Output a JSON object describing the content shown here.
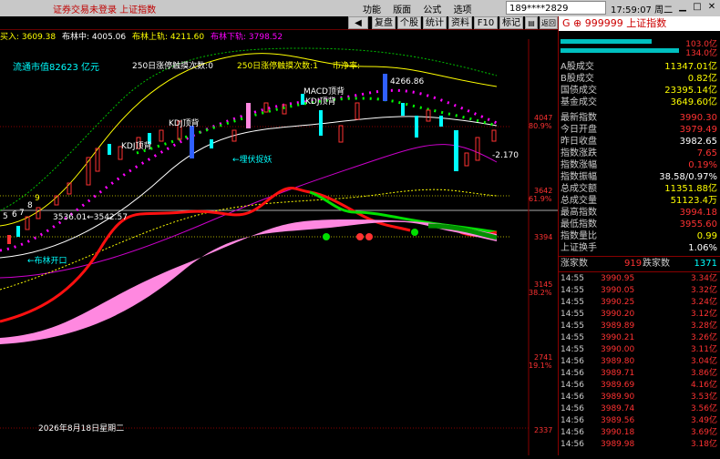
{
  "titlebar": {
    "title": "证券交易未登录  上证指数",
    "menu": [
      "功能",
      "版面",
      "公式",
      "选项"
    ],
    "search_value": "189****2829",
    "clock": "17:59:07 周二"
  },
  "toolbar": {
    "buttons": [
      "",
      "复盘",
      "个股",
      "统计",
      "资料",
      "F10",
      "标记",
      "分类",
      "返回"
    ]
  },
  "indicator_line": {
    "buy": "买入: 3609.38",
    "boll": "布林中: 4005.06",
    "upper": "布林上轨: 4211.60",
    "lower": "布林下轨: 3798.52"
  },
  "chart": {
    "labels": {
      "float_cap": "流通市值82623 亿元",
      "limit_up": "250日涨停触摸次数:0",
      "limit_down": "250日涨停触摸次数:1",
      "net": "市净率:",
      "kdj1": "KDJ顶背",
      "kdj2": "KDJ顶背",
      "macd": "MACD顶背",
      "kdj3": "KDJ顶背",
      "latent": "←埋伏捉妖",
      "boll_open": "←布林开口",
      "high_label": "4266.86",
      "low_label": "3536.01←3542.57",
      "last": "-2.170",
      "date": "2026年8月18日星期二",
      "left_nums": [
        "5",
        "6",
        "7",
        "8",
        "9"
      ]
    },
    "y_ticks": [
      {
        "v": "4047",
        "pct": "80.9%"
      },
      {
        "v": "3642",
        "pct": "61.9%"
      },
      {
        "v": "3394",
        "pct": ""
      },
      {
        "v": "3145",
        "pct": "38.2%"
      },
      {
        "v": "2741",
        "pct": "19.1%"
      },
      {
        "v": "2337",
        "pct": ""
      }
    ],
    "colors": {
      "up": "#ff3232",
      "down": "#00ffff",
      "ma_yellow": "#ffff00",
      "ma_white": "#ffffff",
      "ma_magenta": "#ff00ff",
      "green": "#00e000",
      "pink": "#ff88e0"
    }
  },
  "right_panel": {
    "header": "G  ⊕  999999 上证指数",
    "header_vals": [
      "103.0亿",
      "134.0亿"
    ],
    "stats": [
      {
        "label": "A股成交",
        "value": "11347.01亿",
        "color": "yel"
      },
      {
        "label": "B股成交",
        "value": "0.82亿",
        "color": "yel"
      },
      {
        "label": "国债成交",
        "value": "23395.14亿",
        "color": "yel"
      },
      {
        "label": "基金成交",
        "value": "3649.60亿",
        "color": "yel"
      },
      {
        "label": "最新指数",
        "value": "3990.30",
        "color": "red"
      },
      {
        "label": "今日开盘",
        "value": "3979.49",
        "color": "red"
      },
      {
        "label": "昨日收盘",
        "value": "3982.65",
        "color": "wht"
      },
      {
        "label": "指数涨跌",
        "value": "7.65",
        "color": "red"
      },
      {
        "label": "指数涨幅",
        "value": "0.19%",
        "color": "red"
      },
      {
        "label": "指数振幅",
        "value": "38.58/0.97%",
        "color": "wht"
      },
      {
        "label": "总成交额",
        "value": "11351.88亿",
        "color": "yel"
      },
      {
        "label": "总成交量",
        "value": "51123.4万",
        "color": "yel"
      },
      {
        "label": "最高指数",
        "value": "3994.18",
        "color": "red"
      },
      {
        "label": "最低指数",
        "value": "3955.60",
        "color": "red"
      },
      {
        "label": "指数量比",
        "value": "0.99",
        "color": "yel"
      },
      {
        "label": "上证换手",
        "value": "1.06%",
        "color": "wht"
      }
    ],
    "updown": {
      "up_label": "涨家数",
      "up": "919",
      "down_label": "跌家数",
      "down": "1371"
    },
    "ticks": [
      {
        "t": "14:55",
        "p": "3990.95",
        "s": "3.34亿"
      },
      {
        "t": "14:55",
        "p": "3990.05",
        "s": "3.32亿"
      },
      {
        "t": "14:55",
        "p": "3990.25",
        "s": "3.24亿"
      },
      {
        "t": "14:55",
        "p": "3990.20",
        "s": "3.12亿"
      },
      {
        "t": "14:55",
        "p": "3989.89",
        "s": "3.28亿"
      },
      {
        "t": "14:55",
        "p": "3990.21",
        "s": "3.26亿"
      },
      {
        "t": "14:55",
        "p": "3990.00",
        "s": "3.11亿"
      },
      {
        "t": "14:56",
        "p": "3989.80",
        "s": "3.04亿"
      },
      {
        "t": "14:56",
        "p": "3989.71",
        "s": "3.86亿"
      },
      {
        "t": "14:56",
        "p": "3989.69",
        "s": "4.16亿"
      },
      {
        "t": "14:56",
        "p": "3989.90",
        "s": "3.53亿"
      },
      {
        "t": "14:56",
        "p": "3989.74",
        "s": "3.56亿"
      },
      {
        "t": "14:56",
        "p": "3989.56",
        "s": "3.49亿"
      },
      {
        "t": "14:56",
        "p": "3990.18",
        "s": "3.69亿"
      },
      {
        "t": "14:56",
        "p": "3989.98",
        "s": "3.18亿"
      }
    ]
  }
}
